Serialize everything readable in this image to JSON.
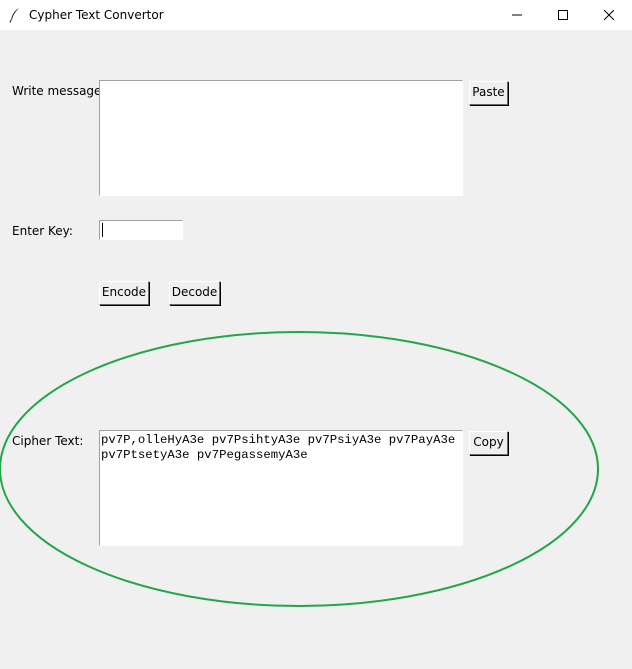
{
  "window": {
    "title": "Cypher Text Convertor",
    "app_icon": "feather-icon",
    "controls": [
      "minimize-icon",
      "maximize-icon",
      "close-icon"
    ]
  },
  "form": {
    "message_label": "Write message:",
    "message_value": "",
    "paste_label": "Paste",
    "key_label": "Enter Key:",
    "key_value": "",
    "encode_label": "Encode",
    "decode_label": "Decode",
    "cipher_label": "Cipher Text:",
    "cipher_value": "pv7P,olleHyA3e pv7PsihtyA3e pv7PsiyA3e pv7PayA3e pv7PtsetyA3e pv7PegassemyA3e",
    "copy_label": "Copy"
  },
  "colors": {
    "background": "#f0f0f0",
    "annotation_ellipse": "#22a64a"
  }
}
